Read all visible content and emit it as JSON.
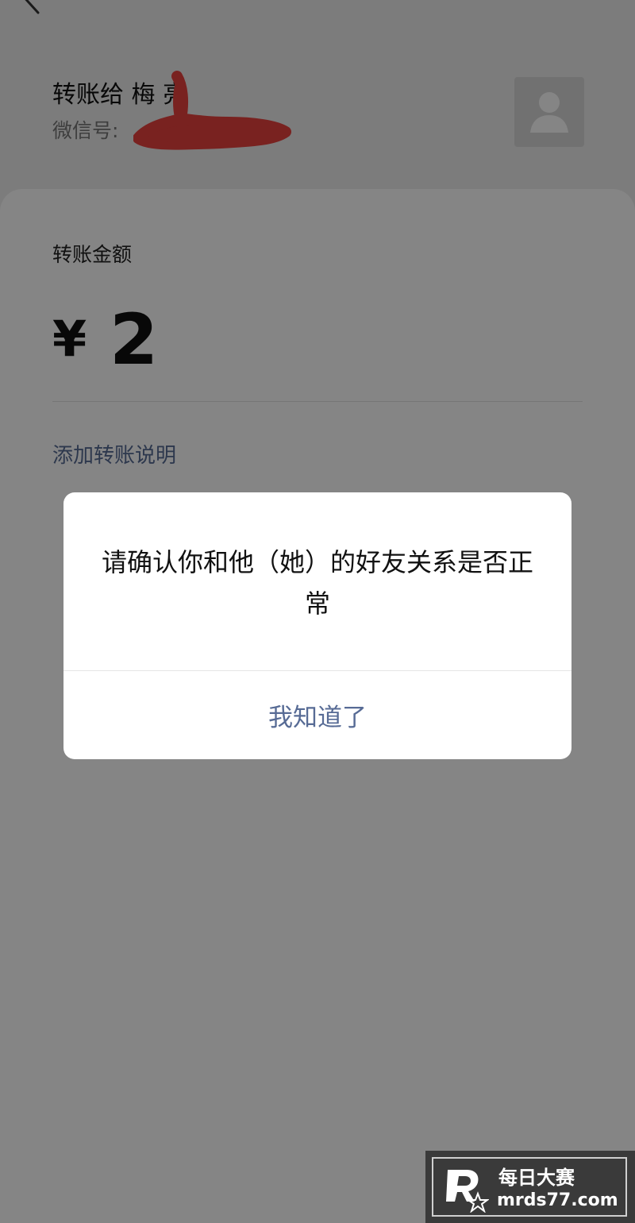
{
  "header": {
    "title": "转账给 梅 亮",
    "subtitle": "微信号:"
  },
  "transfer": {
    "amount_label": "转账金额",
    "currency": "¥",
    "amount": "2",
    "add_note": "添加转账说明"
  },
  "dialog": {
    "message": "请确认你和他（她）的好友关系是否正常",
    "confirm_label": "我知道了"
  },
  "watermark": {
    "title": "每日大赛",
    "url": "mrds77.com"
  },
  "colors": {
    "link": "#576b95",
    "redaction": "#e8413e"
  },
  "icons": {
    "back": "back-arrow-icon",
    "avatar": "user-silhouette-icon"
  }
}
